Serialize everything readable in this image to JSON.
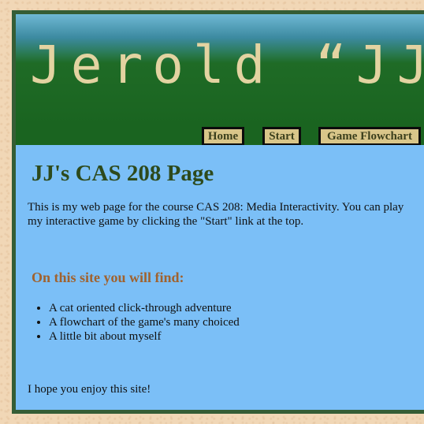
{
  "banner": {
    "title": "Jerold “JJ”"
  },
  "nav": {
    "items": [
      {
        "label": "Home"
      },
      {
        "label": "Start"
      },
      {
        "label": "Game Flowchart"
      }
    ]
  },
  "main": {
    "title": "JJ's CAS 208 Page",
    "intro": "This is my web page for the course CAS 208: Media Interactivity. You can play my interactive game by clicking the \"Start\" link at the top.",
    "subtitle": "On this site you will find:",
    "list": [
      "A cat oriented click-through adventure",
      "A flowchart of the game's many choiced",
      "A little bit about myself"
    ],
    "closing": "I hope you enjoy this site!"
  },
  "colors": {
    "page_background": "#f1d7b6",
    "frame_border": "#355d35",
    "banner_green": "#1a6420",
    "banner_text": "#e3d3a1",
    "nav_button": "#d9c68a",
    "content_background": "#7bbff7",
    "title_text": "#2d4a1c",
    "subtitle_text": "#a0622e"
  }
}
